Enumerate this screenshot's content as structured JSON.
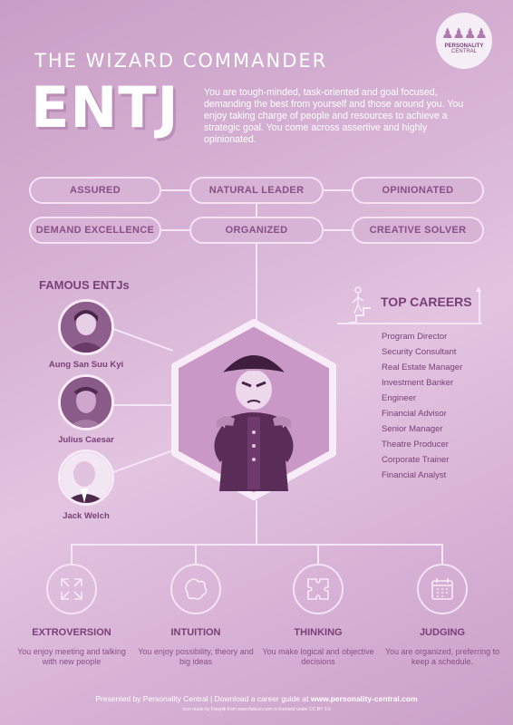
{
  "logo": {
    "line1": "PERSONALITY",
    "line2": "CENTRAL",
    "figures": "♟♟♟♟"
  },
  "header": {
    "subtitle": "THE WIZARD COMMANDER",
    "type": "ENTJ",
    "description": "You are tough-minded, task-oriented and goal focused, demanding the best from yourself and those around you. You enjoy taking charge of people and resources to achieve a strategic goal. You come across assertive and highly opinionated."
  },
  "traits": [
    "ASSURED",
    "NATURAL LEADER",
    "OPINIONATED",
    "DEMAND EXCELLENCE",
    "ORGANIZED",
    "CREATIVE SOLVER"
  ],
  "famous": {
    "title": "FAMOUS ENTJs",
    "people": [
      "Aung San Suu Kyi",
      "Julius Caesar",
      "Jack Welch"
    ]
  },
  "careers": {
    "title": "TOP CAREERS",
    "items": [
      "Program Director",
      "Security Consultant",
      "Real Estate Manager",
      "Investment Banker",
      "Engineer",
      "Financial Advisor",
      "Senior Manager",
      "Theatre Producer",
      "Corporate Trainer",
      "Financial Analyst"
    ]
  },
  "dimensions": [
    {
      "name": "EXTROVERSION",
      "desc": "You enjoy meeting and talking with new people",
      "icon": "arrows-out-icon"
    },
    {
      "name": "INTUITION",
      "desc": "You enjoy possibility, theory and big ideas",
      "icon": "blob-icon"
    },
    {
      "name": "THINKING",
      "desc": "You make logical and objective decisions",
      "icon": "puzzle-icon"
    },
    {
      "name": "JUDGING",
      "desc": "You are organized, preferring to keep a schedule.",
      "icon": "calendar-icon"
    }
  ],
  "footer": {
    "prefix": "Presented by Personality Central  |  Download a career guide at ",
    "url": "www.personality-central.com",
    "credit": "Icon made by Freepik from www.flaticon.com is licensed under CC BY 3.0"
  }
}
